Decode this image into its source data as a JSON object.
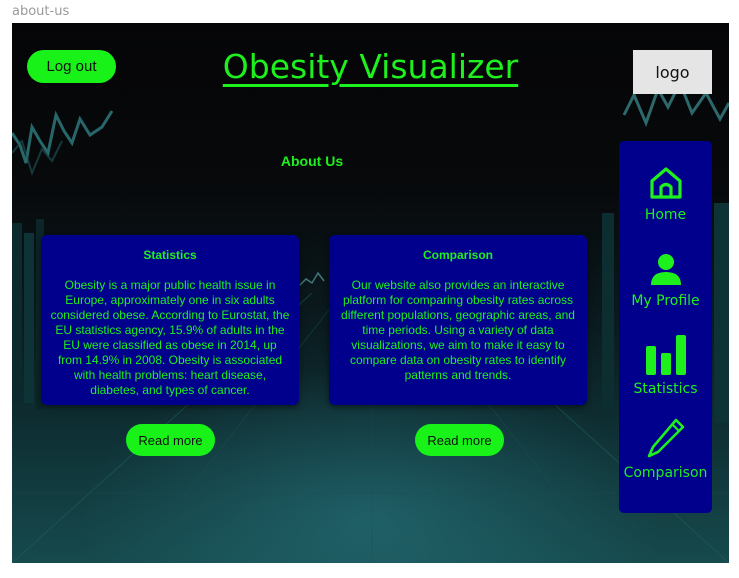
{
  "frame_label": "about-us",
  "header": {
    "logout_label": "Log out",
    "title": "Obesity Visualizer",
    "logo_label": "logo"
  },
  "main": {
    "heading": "About Us",
    "cards": [
      {
        "title": "Statistics",
        "body": "Obesity is a major public health issue in Europe, approximately one in six adults considered obese. According to Eurostat, the EU statistics agency, 15.9% of adults in the EU were classified as obese in 2014, up from 14.9% in 2008. Obesity is associated with health problems: heart disease, diabetes, and types of cancer.",
        "button_label": "Read more"
      },
      {
        "title": "Comparison",
        "body": "Our website also provides an interactive platform for comparing obesity rates across different populations, geographic areas, and time periods. Using a variety of data visualizations, we aim to make it easy to compare data on obesity rates to identify patterns and trends.",
        "button_label": "Read more"
      }
    ]
  },
  "sidebar": {
    "items": [
      {
        "label": "Home",
        "icon": "home-icon"
      },
      {
        "label": "My Profile",
        "icon": "user-icon"
      },
      {
        "label": "Statistics",
        "icon": "bar-chart-icon"
      },
      {
        "label": "Comparison",
        "icon": "pencil-icon"
      }
    ]
  },
  "colors": {
    "accent_green": "#1ef01e",
    "panel_blue": "#00008d",
    "logo_box": "#e5e5e5"
  }
}
